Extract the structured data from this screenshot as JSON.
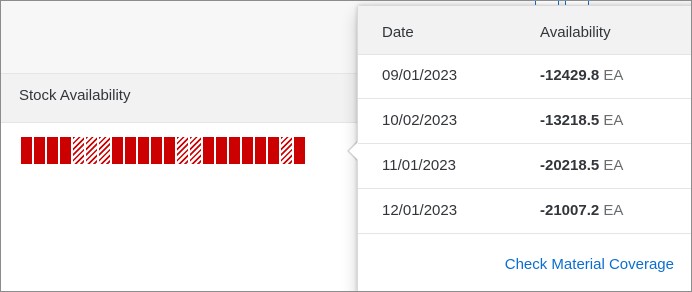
{
  "table": {
    "column_header": "Stock Availability",
    "micro_chart": {
      "segments": [
        "solid",
        "solid",
        "solid",
        "solid",
        "hatched",
        "hatched",
        "hatched",
        "solid",
        "solid",
        "solid",
        "solid",
        "solid",
        "hatched",
        "hatched",
        "solid",
        "solid",
        "solid",
        "solid",
        "solid",
        "solid",
        "hatched",
        "solid"
      ],
      "solid_color": "#cc0000"
    }
  },
  "popover": {
    "headers": {
      "date": "Date",
      "availability": "Availability"
    },
    "rows": [
      {
        "date": "09/01/2023",
        "value": "-12429.8",
        "unit": "EA"
      },
      {
        "date": "10/02/2023",
        "value": "-13218.5",
        "unit": "EA"
      },
      {
        "date": "11/01/2023",
        "value": "-20218.5",
        "unit": "EA"
      },
      {
        "date": "12/01/2023",
        "value": "-21007.2",
        "unit": "EA"
      }
    ],
    "footer_link": "Check Material Coverage"
  },
  "colors": {
    "link": "#0a6ed1",
    "chart_red": "#cc0000",
    "header_bg": "#f2f2f2"
  }
}
